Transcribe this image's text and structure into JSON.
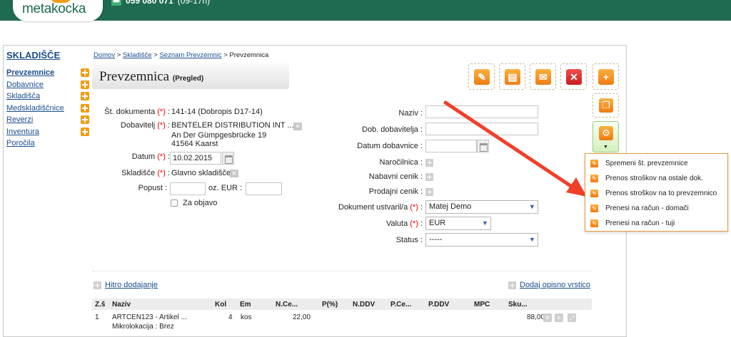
{
  "header": {
    "logo_text": "metakocka",
    "phone": "059 080 071",
    "hours": "(09-17h)"
  },
  "sidebar": {
    "title": "SKLADIŠČE",
    "items": [
      {
        "label": "Prevzemnice",
        "active": true,
        "plus": true
      },
      {
        "label": "Dobavnice",
        "plus": true
      },
      {
        "label": "Skladišča",
        "plus": true
      },
      {
        "label": "Medskladiščnice",
        "plus": true
      },
      {
        "label": "Reverzi",
        "plus": true
      },
      {
        "label": "Inventura",
        "plus": true
      },
      {
        "label": "Poročila",
        "plus": false
      }
    ]
  },
  "breadcrumb": {
    "home": "Domov",
    "section": "Skladišče",
    "list": "Seznam Prevzemnic",
    "current": "Prevzemnica",
    "sep": ">"
  },
  "title": {
    "main": "Prevzemnica",
    "sub": "(Pregled)"
  },
  "req_mark": "(*)",
  "form_left": {
    "doc_no_label": "Št. dokumenta",
    "doc_no": "141-14 (Dobropis D17-14)",
    "supplier_label": "Dobavitelj",
    "supplier_name": "BENTELER DISTRIBUTION INT ...",
    "supplier_street": "An Der Gümpgesbrücke 19",
    "supplier_city": "41564 Kaarst",
    "date_label": "Datum",
    "date": "10.02.2015",
    "warehouse_label": "Skladišče",
    "warehouse": "Glavno skladišče",
    "discount_label": "Popust :",
    "eur_label": "oz. EUR :",
    "publish_label": "Za objavo"
  },
  "form_right": {
    "name_label": "Naziv :",
    "supplier_doc_label": "Dob. dobavitelja :",
    "delivery_date_label": "Datum dobavnice :",
    "order_label": "Naročilnica :",
    "purchase_price_label": "Nabavni cenik :",
    "sales_price_label": "Prodajni cenik :",
    "creator_label": "Dokument ustvaril/a",
    "creator": "Matej Demo",
    "currency_label": "Valuta",
    "currency": "EUR",
    "status_label": "Status :",
    "status": "-----"
  },
  "menu": {
    "items": [
      "Spremeni št. prevzemnice",
      "Prenos stroškov na ostale dok.",
      "Prenos stroškov na to prevzemnico",
      "Prenesi na račun - domači",
      "Prenesi na račun - tuji"
    ]
  },
  "actions": {
    "quick_add": "Hitro dodajanje",
    "add_desc_row": "Dodaj opisno vrstico"
  },
  "table": {
    "columns": [
      "Z.š",
      "Naziv",
      "Kol",
      "Em",
      "N.Ce...",
      "P(%)",
      "N.DDV",
      "P.Ce...",
      "P.DDV",
      "MPC",
      "Sku..."
    ],
    "rows": [
      {
        "zs": "1",
        "naziv": "ARTCEN123 - Artikel ...",
        "naziv2": "Mikrolokacija : Brez",
        "kol": "4",
        "em": "kos",
        "nce": "22,00",
        "sku": "88,00"
      }
    ]
  },
  "icons": {
    "edit": "pencil-icon",
    "print": "printer-icon",
    "mail": "envelope-icon",
    "delete": "close-icon",
    "add": "plus-icon",
    "copy": "copy-icon",
    "settings": "gear-icon"
  },
  "colors": {
    "brand": "#1e6b52",
    "accent": "#f39c12",
    "link": "#1a4d8f",
    "danger": "#d32f2f",
    "arrow": "#f0402a"
  }
}
